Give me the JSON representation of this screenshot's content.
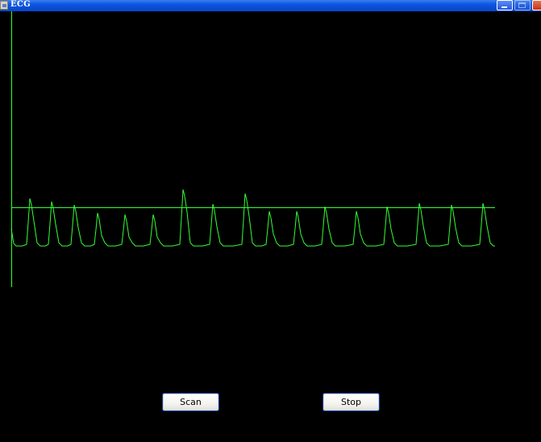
{
  "window": {
    "title": "ECG"
  },
  "titlebar": {
    "icons": [
      "app-icon",
      "minimize-icon",
      "maximize-icon",
      "close-icon"
    ]
  },
  "buttons": {
    "scan_label": "Scan",
    "stop_label": "Stop"
  },
  "ecg": {
    "trace_color": "#33ff33",
    "background_color": "#000000",
    "beat_count": 16
  }
}
